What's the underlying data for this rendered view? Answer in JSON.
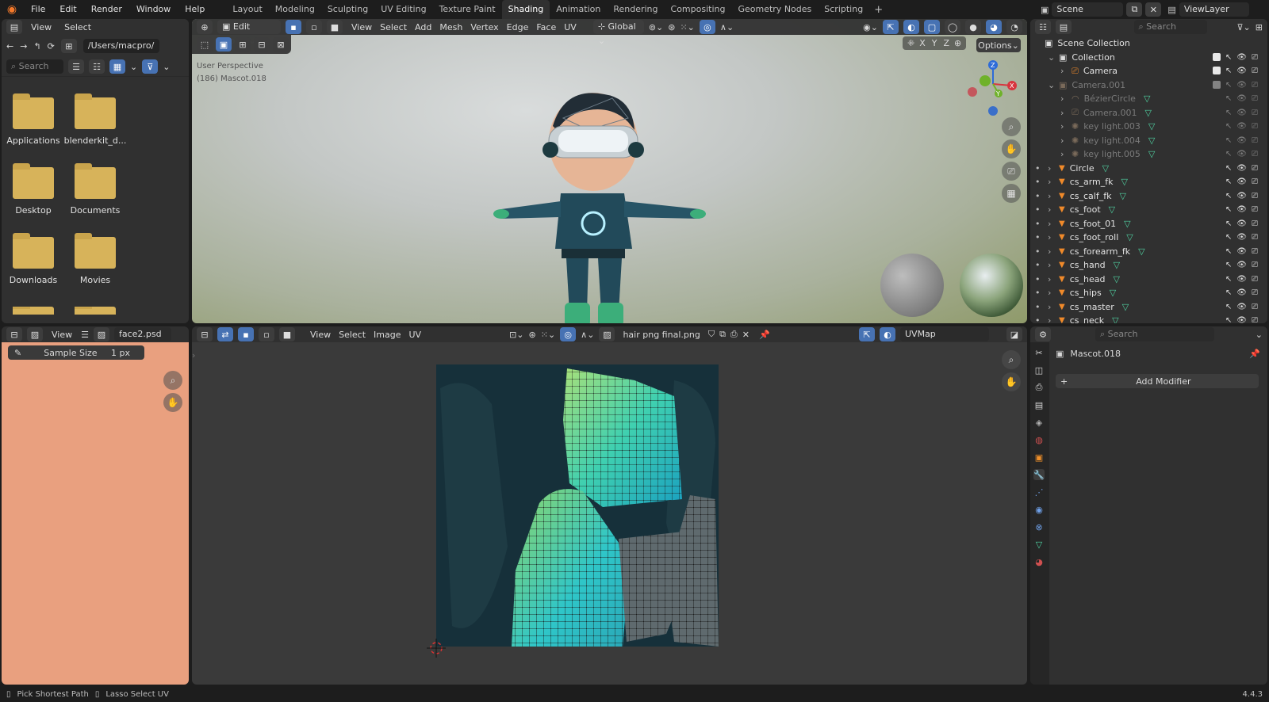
{
  "topbar": {
    "menus": [
      "File",
      "Edit",
      "Render",
      "Window",
      "Help"
    ],
    "workspaces": [
      "Layout",
      "Modeling",
      "Sculpting",
      "UV Editing",
      "Texture Paint",
      "Shading",
      "Animation",
      "Rendering",
      "Compositing",
      "Geometry Nodes",
      "Scripting"
    ],
    "active_workspace": "Shading",
    "scene": "Scene",
    "view_layer": "ViewLayer"
  },
  "filebrowser": {
    "menu_view": "View",
    "menu_select": "Select",
    "path": "/Users/macpro/",
    "search_placeholder": "Search",
    "items": [
      "Applications",
      "blenderkit_d...",
      "Desktop",
      "Documents",
      "Downloads",
      "Movies"
    ]
  },
  "viewport": {
    "mode": "Edit Mode",
    "menus": [
      "View",
      "Select",
      "Add",
      "Mesh",
      "Vertex",
      "Edge",
      "Face",
      "UV"
    ],
    "orientation": "Global",
    "options": "Options",
    "axes": [
      "X",
      "Y",
      "Z"
    ],
    "overlay_line1": "User Perspective",
    "overlay_line2": "(186) Mascot.018"
  },
  "image_panel": {
    "menu_view": "View",
    "image_name": "face2.psd",
    "tool_label": "Sample Size",
    "tool_value": "1 px",
    "swatch_color": "#e9a07f"
  },
  "uv_editor": {
    "menus": [
      "View",
      "Select",
      "Image",
      "UV"
    ],
    "image_name": "hair png final.png",
    "uvmap": "UVMap"
  },
  "outliner": {
    "search_placeholder": "Search",
    "root": "Scene Collection",
    "rows": [
      {
        "label": "Collection",
        "dim": false
      },
      {
        "label": "Camera",
        "dim": false
      },
      {
        "label": "Camera.001",
        "dim": true
      },
      {
        "label": "BézierCircle",
        "dim": true
      },
      {
        "label": "Camera.001",
        "dim": true
      },
      {
        "label": "key light.003",
        "dim": true
      },
      {
        "label": "key light.004",
        "dim": true
      },
      {
        "label": "key light.005",
        "dim": true
      },
      {
        "label": "Circle",
        "dim": false
      },
      {
        "label": "cs_arm_fk",
        "dim": false
      },
      {
        "label": "cs_calf_fk",
        "dim": false
      },
      {
        "label": "cs_foot",
        "dim": false
      },
      {
        "label": "cs_foot_01",
        "dim": false
      },
      {
        "label": "cs_foot_roll",
        "dim": false
      },
      {
        "label": "cs_forearm_fk",
        "dim": false
      },
      {
        "label": "cs_hand",
        "dim": false
      },
      {
        "label": "cs_head",
        "dim": false
      },
      {
        "label": "cs_hips",
        "dim": false
      },
      {
        "label": "cs_master",
        "dim": false
      },
      {
        "label": "cs_neck",
        "dim": false
      }
    ]
  },
  "properties": {
    "search_placeholder": "Search",
    "object_name": "Mascot.018",
    "add_modifier": "Add Modifier"
  },
  "statusbar": {
    "left1": "Pick Shortest Path",
    "left2": "Lasso Select UV",
    "version": "4.4.3"
  }
}
